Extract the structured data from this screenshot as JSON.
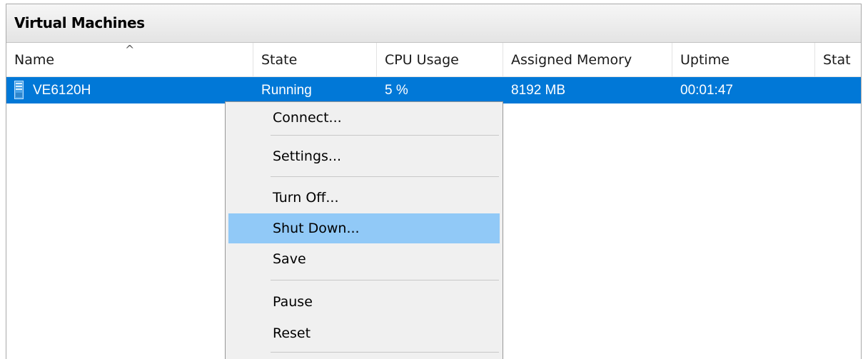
{
  "pane": {
    "title": "Virtual Machines"
  },
  "columns": [
    {
      "label": "Name"
    },
    {
      "label": "State"
    },
    {
      "label": "CPU Usage"
    },
    {
      "label": "Assigned Memory"
    },
    {
      "label": "Uptime"
    },
    {
      "label": "Stat"
    }
  ],
  "sort_indicator": "^",
  "vm": {
    "name": "VE6120H",
    "state": "Running",
    "cpu": "5 %",
    "memory": "8192 MB",
    "uptime": "00:01:47",
    "icon": "vm-server-icon"
  },
  "context_menu": {
    "items": [
      {
        "label": "Connect..."
      },
      {
        "label": "Settings..."
      },
      {
        "label": "Turn Off..."
      },
      {
        "label": "Shut Down...",
        "highlighted": true
      },
      {
        "label": "Save"
      },
      {
        "label": "Pause"
      },
      {
        "label": "Reset"
      }
    ]
  },
  "colors": {
    "selection": "#0178d7",
    "menu_highlight": "#91c9f7",
    "menu_background": "#f0f0f0"
  }
}
